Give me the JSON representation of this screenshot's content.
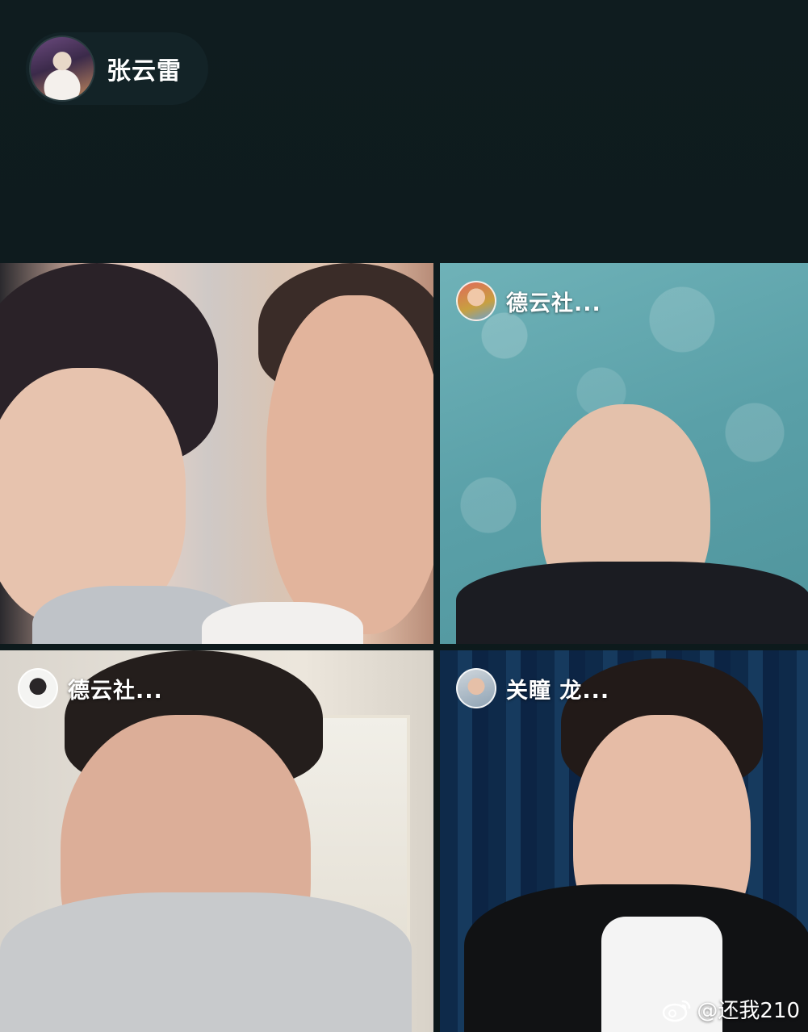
{
  "host": {
    "name": "张云雷",
    "avatar_icon": "host-avatar"
  },
  "participants": [
    {
      "name": "德云社...",
      "avatar_icon": "participant-avatar"
    },
    {
      "name": "德云社...",
      "avatar_icon": "participant-avatar"
    },
    {
      "name": "关瞳 龙...",
      "avatar_icon": "participant-avatar"
    }
  ],
  "watermark": {
    "text": "@还我210",
    "icon": "weibo-icon"
  },
  "colors": {
    "background": "#0e1a1c",
    "cloud_wall": "#5aa0a8",
    "curtain": "#163a5e"
  }
}
